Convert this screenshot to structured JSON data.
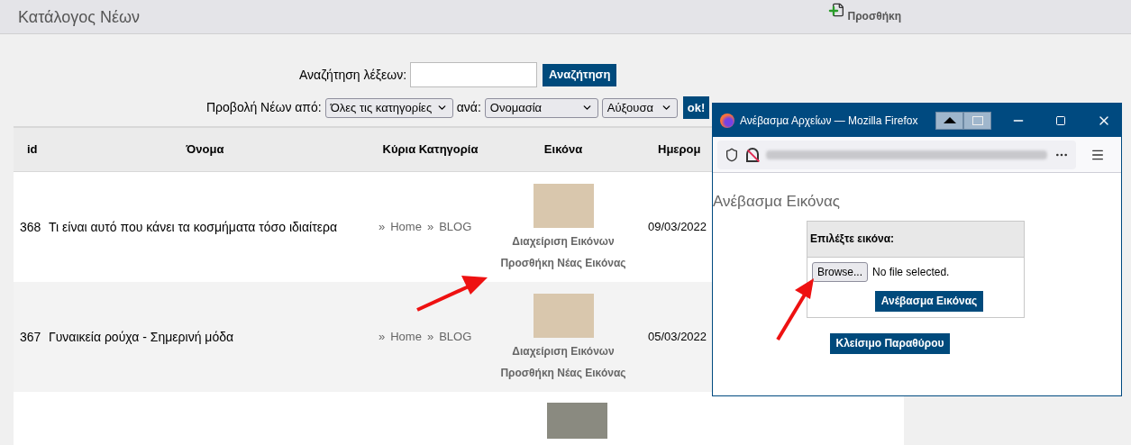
{
  "page_title": "Κατάλογος Νέων",
  "add_link": "Προσθήκη",
  "search": {
    "label": "Αναζήτηση λέξεων:",
    "button": "Αναζήτηση"
  },
  "filter": {
    "label": "Προβολή Νέων από:",
    "category": "Όλες τις κατηγορίες",
    "by_label": "ανά:",
    "sort_field": "Ονομασία",
    "order": "Αύξουσα",
    "button": "ok!"
  },
  "table": {
    "columns": [
      "id",
      "Όνομα",
      "Κύρια Κατηγορία",
      "Εικόνα",
      "Ημερομ"
    ],
    "rows": [
      {
        "id": "368",
        "name": "Τι είναι αυτό που κάνει τα κοσμήματα τόσο ιδιαίτερα",
        "category": [
          {
            "sep": "»",
            "label": "Home"
          },
          {
            "sep": "»",
            "label": "BLOG"
          }
        ],
        "links": [
          "Διαχείριση Εικόνων",
          "Προσθήκη Νέας Εικόνας"
        ],
        "date": "09/03/2022"
      },
      {
        "id": "367",
        "name": "Γυναικεία ρούχα - Σημερινή μόδα",
        "category": [
          {
            "sep": "»",
            "label": "Home"
          },
          {
            "sep": "»",
            "label": "BLOG"
          }
        ],
        "links": [
          "Διαχείριση Εικόνων",
          "Προσθήκη Νέας Εικόνας"
        ],
        "date": "05/03/2022"
      }
    ]
  },
  "popup": {
    "window_title": "Ανέβασμα Αρχείων — Mozilla Firefox",
    "heading": "Ανέβασμα Εικόνας",
    "box_title": "Επιλέξτε εικόνα:",
    "browse_button": "Browse...",
    "file_status": "No file selected.",
    "upload_button": "Ανέβασμα Εικόνας",
    "close_button": "Κλείσιμο Παραθύρου"
  }
}
